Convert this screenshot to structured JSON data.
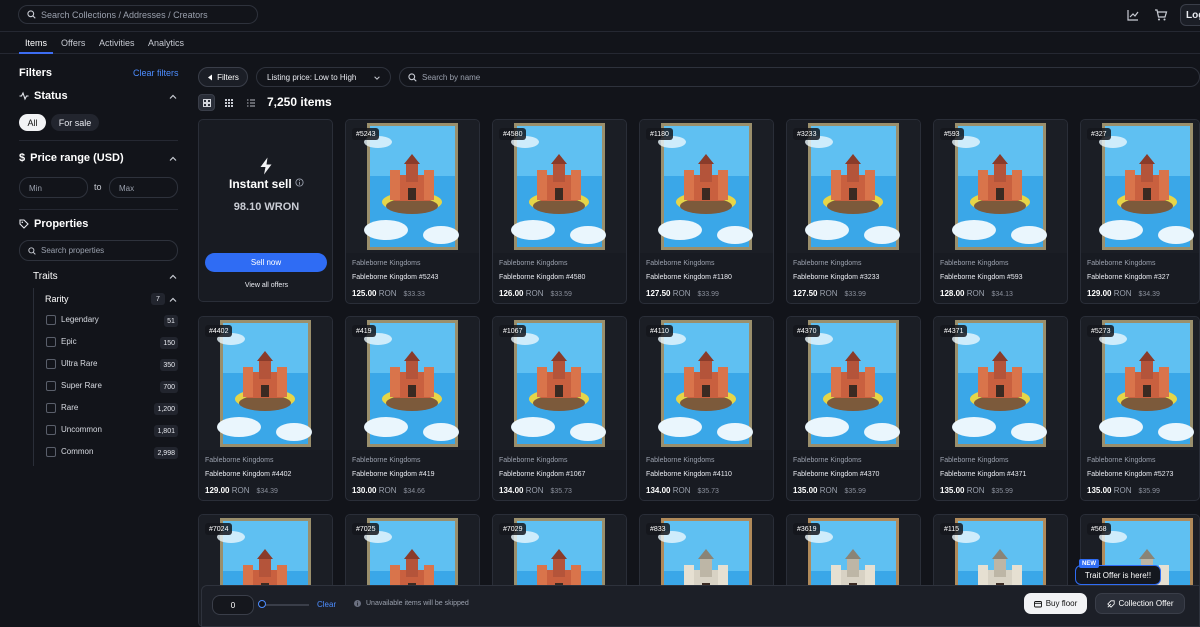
{
  "header": {
    "search_placeholder": "Search Collections / Addresses / Creators",
    "login_label": "Log"
  },
  "tabs": [
    "Items",
    "Offers",
    "Activities",
    "Analytics"
  ],
  "sidebar": {
    "title": "Filters",
    "clear_filters": "Clear filters",
    "status": {
      "title": "Status",
      "options": [
        "All",
        "For sale"
      ],
      "selected": "All"
    },
    "price": {
      "title": "Price range (USD)",
      "min_placeholder": "Min",
      "to": "to",
      "max_placeholder": "Max"
    },
    "properties": {
      "title": "Properties",
      "search_placeholder": "Search properties",
      "traits_label": "Traits",
      "rarity": {
        "label": "Rarity",
        "count": "7",
        "items": [
          {
            "name": "Legendary",
            "count": "51"
          },
          {
            "name": "Epic",
            "count": "150"
          },
          {
            "name": "Ultra Rare",
            "count": "350"
          },
          {
            "name": "Super Rare",
            "count": "700"
          },
          {
            "name": "Rare",
            "count": "1,200"
          },
          {
            "name": "Uncommon",
            "count": "1,801"
          },
          {
            "name": "Common",
            "count": "2,998"
          }
        ]
      }
    }
  },
  "toolbar": {
    "filters_label": "Filters",
    "sort_label": "Listing price: Low to High",
    "search_placeholder": "Search by name",
    "items_count": "7,250 items"
  },
  "instant_sell": {
    "title": "Instant sell",
    "price": "98.10 WRON",
    "sell_now": "Sell now",
    "view_all_offers": "View all offers"
  },
  "collection_name": "Fableborne Kingdoms",
  "currency": "RON",
  "cards": [
    {
      "id": "#5243",
      "name": "Fableborne Kingdom #5243",
      "price": "125.00",
      "usd": "$33.33"
    },
    {
      "id": "#4580",
      "name": "Fableborne Kingdom #4580",
      "price": "126.00",
      "usd": "$33.59"
    },
    {
      "id": "#1180",
      "name": "Fableborne Kingdom #1180",
      "price": "127.50",
      "usd": "$33.99"
    },
    {
      "id": "#3233",
      "name": "Fableborne Kingdom #3233",
      "price": "127.50",
      "usd": "$33.99"
    },
    {
      "id": "#593",
      "name": "Fableborne Kingdom #593",
      "price": "128.00",
      "usd": "$34.13"
    },
    {
      "id": "#327",
      "name": "Fableborne Kingdom #327",
      "price": "129.00",
      "usd": "$34.39"
    },
    {
      "id": "#4402",
      "name": "Fableborne Kingdom #4402",
      "price": "129.00",
      "usd": "$34.39"
    },
    {
      "id": "#419",
      "name": "Fableborne Kingdom #419",
      "price": "130.00",
      "usd": "$34.66"
    },
    {
      "id": "#1067",
      "name": "Fableborne Kingdom #1067",
      "price": "134.00",
      "usd": "$35.73"
    },
    {
      "id": "#4110",
      "name": "Fableborne Kingdom #4110",
      "price": "134.00",
      "usd": "$35.73"
    },
    {
      "id": "#4370",
      "name": "Fableborne Kingdom #4370",
      "price": "135.00",
      "usd": "$35.99"
    },
    {
      "id": "#4371",
      "name": "Fableborne Kingdom #4371",
      "price": "135.00",
      "usd": "$35.99"
    },
    {
      "id": "#5273",
      "name": "Fableborne Kingdom #5273",
      "price": "135.00",
      "usd": "$35.99"
    },
    {
      "id": "#7024"
    },
    {
      "id": "#7025"
    },
    {
      "id": "#7029"
    },
    {
      "id": "#833"
    },
    {
      "id": "#3619"
    },
    {
      "id": "#115"
    },
    {
      "id": "#568"
    }
  ],
  "bottom_bar": {
    "quantity": "0",
    "clear": "Clear",
    "note": "Unavailable items will be skipped",
    "buy_floor": "Buy floor",
    "collection_offer": "Collection Offer"
  },
  "promo": {
    "badge": "NEW",
    "text": "Trait Offer is here!!"
  },
  "colors": {
    "accent": "#2f6cf4",
    "link": "#4d8dff",
    "background": "#12141a",
    "card": "#181b22"
  }
}
